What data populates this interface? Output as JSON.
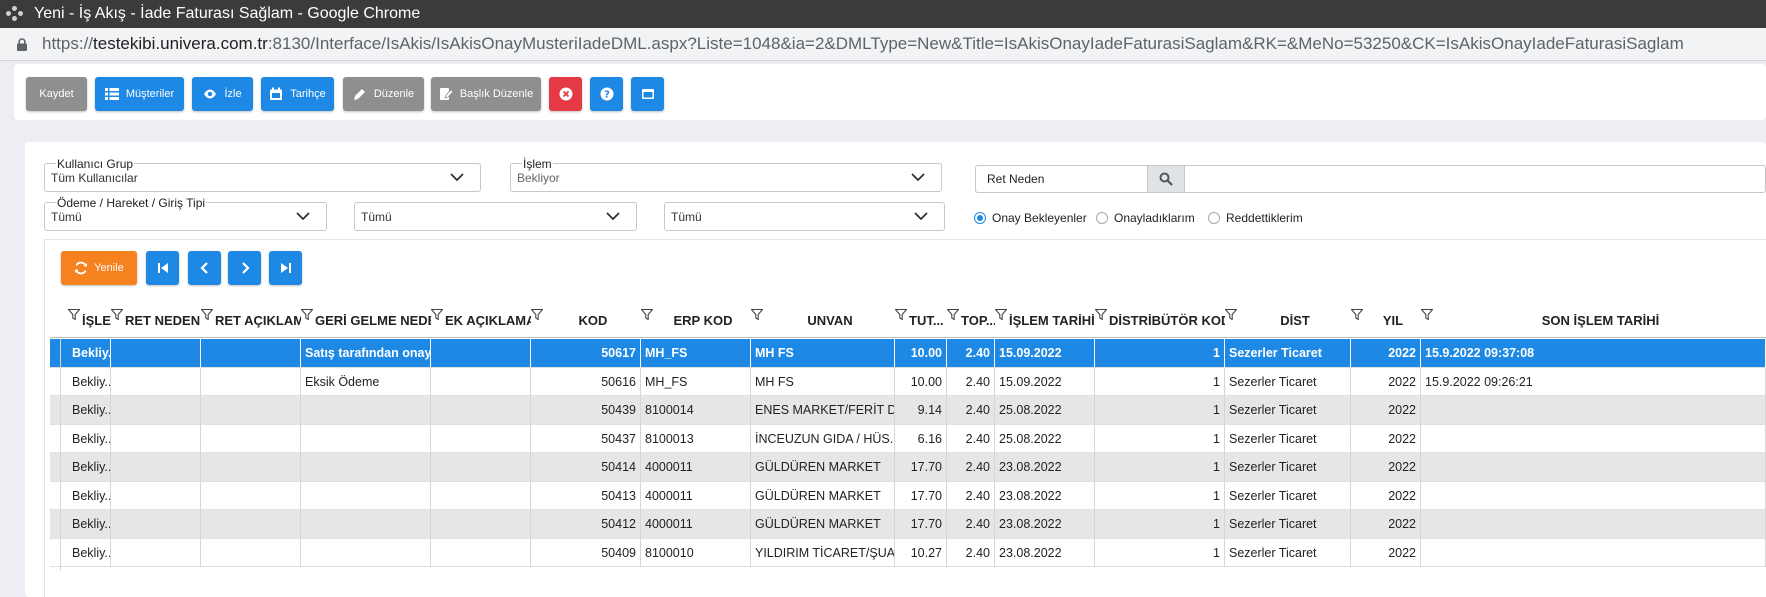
{
  "window": {
    "title": "Yeni - İş Akış - İade Faturası Sağlam - Google Chrome"
  },
  "address": {
    "host": "testekibi.univera.com.tr",
    "rest": ":8130/Interface/IsAkis/IsAkisOnayMusteriIadeDML.aspx?Liste=1048&ia=2&DMLType=New&Title=IsAkisOnayIadeFaturasiSaglam&RK=&MeNo=53250&CK=IsAkisOnayIadeFaturasiSaglam"
  },
  "toolbar": {
    "kaydet": "Kaydet",
    "musteriler": "Müşteriler",
    "izle": "İzle",
    "tarihce": "Tarihçe",
    "duzenle": "Düzenle",
    "baslik_duzenle": "Başlık Düzenle"
  },
  "filters": {
    "kullanici_grup": {
      "label": "Kullanıcı Grup",
      "value": "Tüm Kullanıcılar"
    },
    "islem": {
      "label": "İşlem",
      "value": "Bekliyor"
    },
    "odeme_tipi": {
      "label": "Ödeme / Hareket / Giriş Tipi",
      "value": "Tümü"
    },
    "filter2": {
      "value": "Tümü"
    },
    "filter3": {
      "value": "Tümü"
    },
    "ret_neden": {
      "label": "Ret Neden"
    }
  },
  "radios": [
    {
      "label": "Onay Bekleyenler",
      "checked": true
    },
    {
      "label": "Onayladıklarım",
      "checked": false
    },
    {
      "label": "Reddettiklerim",
      "checked": false
    }
  ],
  "nav": {
    "yenile": "Yenile"
  },
  "grid": {
    "columns": [
      "İŞLEM",
      "RET NEDEN",
      "RET AÇIKLAMA",
      "GERİ GELME NEDENİ",
      "EK AÇIKLAMA",
      "KOD",
      "ERP KOD",
      "UNVAN",
      "TUT...",
      "TOP...",
      "İŞLEM TARİHİ",
      "DİSTRİBÜTÖR KODU",
      "DİST",
      "YIL",
      "SON İŞLEM TARİHİ"
    ],
    "rows": [
      [
        "Bekliy...",
        "",
        "",
        "Satış tarafından onay...",
        "",
        "50617",
        "MH_FS",
        "MH FS",
        "10.00",
        "2.40",
        "15.09.2022",
        "1",
        "Sezerler Ticaret",
        "2022",
        "15.9.2022 09:37:08"
      ],
      [
        "Bekliy...",
        "",
        "",
        "Eksik Ödeme",
        "",
        "50616",
        "MH_FS",
        "MH FS",
        "10.00",
        "2.40",
        "15.09.2022",
        "1",
        "Sezerler Ticaret",
        "2022",
        "15.9.2022 09:26:21"
      ],
      [
        "Bekliy...",
        "",
        "",
        "",
        "",
        "50439",
        "8100014",
        "ENES MARKET/FERİT D...",
        "9.14",
        "2.40",
        "25.08.2022",
        "1",
        "Sezerler Ticaret",
        "2022",
        ""
      ],
      [
        "Bekliy...",
        "",
        "",
        "",
        "",
        "50437",
        "8100013",
        "İNCEUZUN GIDA / HÜS...",
        "6.16",
        "2.40",
        "25.08.2022",
        "1",
        "Sezerler Ticaret",
        "2022",
        ""
      ],
      [
        "Bekliy...",
        "",
        "",
        "",
        "",
        "50414",
        "4000011",
        "GÜLDÜREN MARKET",
        "17.70",
        "2.40",
        "23.08.2022",
        "1",
        "Sezerler Ticaret",
        "2022",
        ""
      ],
      [
        "Bekliy...",
        "",
        "",
        "",
        "",
        "50413",
        "4000011",
        "GÜLDÜREN MARKET",
        "17.70",
        "2.40",
        "23.08.2022",
        "1",
        "Sezerler Ticaret",
        "2022",
        ""
      ],
      [
        "Bekliy...",
        "",
        "",
        "",
        "",
        "50412",
        "4000011",
        "GÜLDÜREN MARKET",
        "17.70",
        "2.40",
        "23.08.2022",
        "1",
        "Sezerler Ticaret",
        "2022",
        ""
      ],
      [
        "Bekliy...",
        "",
        "",
        "",
        "",
        "50409",
        "8100010",
        "YILDIRIM TİCARET/ŞUA...",
        "10.27",
        "2.40",
        "23.08.2022",
        "1",
        "Sezerler Ticaret",
        "2022",
        ""
      ]
    ],
    "selected_row": 0
  }
}
